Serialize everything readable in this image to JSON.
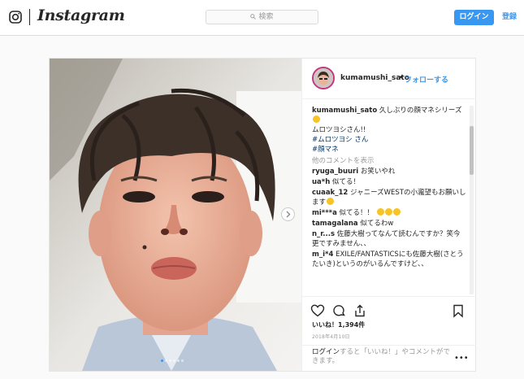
{
  "nav": {
    "wordmark": "Instagram",
    "search_placeholder": "検索",
    "login_button": "ログイン",
    "signup_link": "登録"
  },
  "post": {
    "header": {
      "username": "kumamushi_sato",
      "separator": "•",
      "follow": "フォローする"
    },
    "caption": {
      "username": "kumamushi_sato",
      "line1": " 久しぶりの顔マネシリーズ",
      "line2": "ムロツヨシさん!!",
      "tag1": "#ムロツヨシ さん",
      "tag2": "#顔マネ"
    },
    "more_comments": "他のコメントを表示",
    "comments": [
      {
        "user": "ryuga_buuri",
        "text": " お笑いやれ"
      },
      {
        "user": "ua*h",
        "text": " 似てる！"
      },
      {
        "user": "cuaak_12",
        "text": " ジャニーズWESTの小瀧望もお願いします"
      },
      {
        "user": "mi***a",
        "text": " 似てる！！"
      },
      {
        "user": "tamagalana",
        "text": " 似てるわw"
      },
      {
        "user": "n_r...s",
        "text": " 佐藤大樹ってなんて読むんですか？笑今更ですみません、、"
      },
      {
        "user": "m_i*4",
        "text": " EXILE/FANTASTICSにも佐藤大樹(さとうたいき)というのがいるんですけど、、"
      }
    ],
    "likes": "いいね！1,394件",
    "date": "2018年4月10日",
    "login_prompt": {
      "link": "ログイン",
      "rest": "すると「いいね！」やコメントができます。"
    },
    "more_options": "•••"
  },
  "colors": {
    "accent": "#3897f0",
    "hashtag": "#003569",
    "muted": "#999999"
  }
}
